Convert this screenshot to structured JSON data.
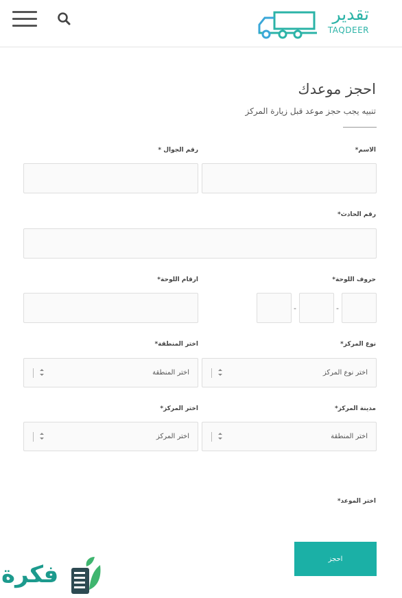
{
  "header": {
    "logo_ar": "تقدير",
    "logo_en": "TAQDEER"
  },
  "form": {
    "title": "احجز موعدك",
    "subtitle": "تنبيه يجب حجز موعد قبل زيارة المركز",
    "name_label": "الاسم*",
    "mobile_label": "رقم الجوال *",
    "accident_label": "رقم الحادث*",
    "plate_letters_label": "حروف اللوحة*",
    "plate_numbers_label": "ارقام اللوحة*",
    "plate_sep": "-",
    "center_type_label": "نوع المركز*",
    "center_type_value": "اختر نوع المركز",
    "region_label": "اختر المنطقة*",
    "region_value": "اختر المنطقة",
    "center_city_label": "مدينة المركز*",
    "center_city_value": "اختر المنطقة",
    "center_label": "اختر المركز*",
    "center_value": "اختر المركز",
    "appointment_label": "اختر الموعد*",
    "submit_label": "احجز"
  },
  "watermark": {
    "text": "فكرة"
  },
  "colors": {
    "accent": "#1bb0a6",
    "logo": "#2bb3a7"
  }
}
